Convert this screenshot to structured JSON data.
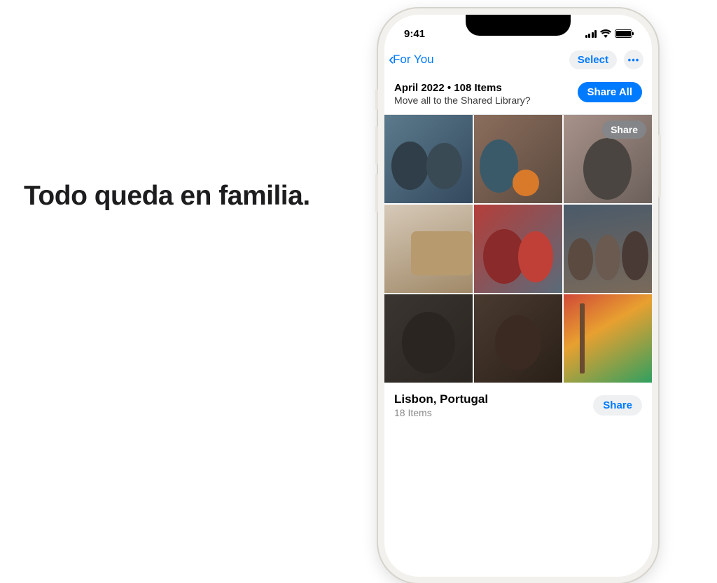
{
  "headline": "Todo queda en familia.",
  "status_bar": {
    "time": "9:41"
  },
  "nav": {
    "back_label": "For You",
    "select_label": "Select",
    "more_label": "•••"
  },
  "section": {
    "title": "April 2022 • 108 Items",
    "subtitle": "Move all to the Shared Library?",
    "share_all_label": "Share All"
  },
  "grid": {
    "overlay_share_label": "Share"
  },
  "footer": {
    "title": "Lisbon, Portugal",
    "subtitle": "18 Items",
    "share_label": "Share"
  }
}
